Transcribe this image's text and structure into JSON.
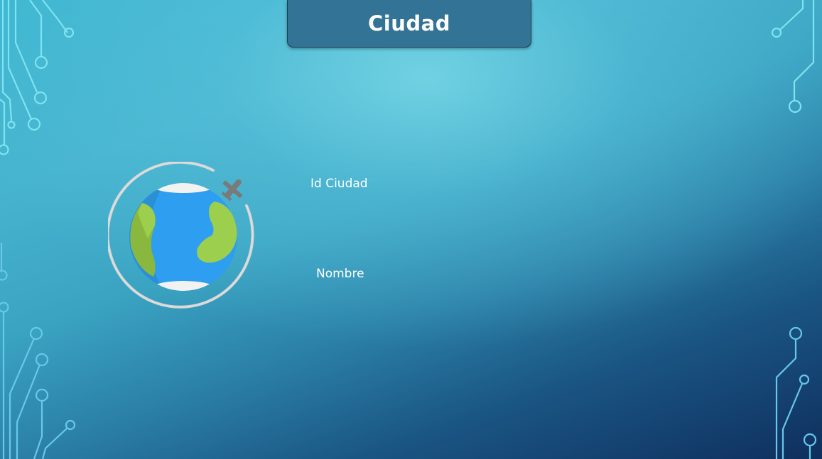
{
  "slide": {
    "title": "Ciudad"
  },
  "fields": {
    "id_label": "Id Ciudad",
    "name_label": "Nombre"
  },
  "icons": {
    "globe": "globe-with-airplane-icon",
    "decoration": "circuit-board-lines"
  },
  "colors": {
    "title_background": "#337396",
    "text": "#ffffff",
    "ocean": "#2d9ef0",
    "land": "#9ccf4d",
    "orbit": "#d5d5d5",
    "airplane": "#7a7a7a"
  }
}
